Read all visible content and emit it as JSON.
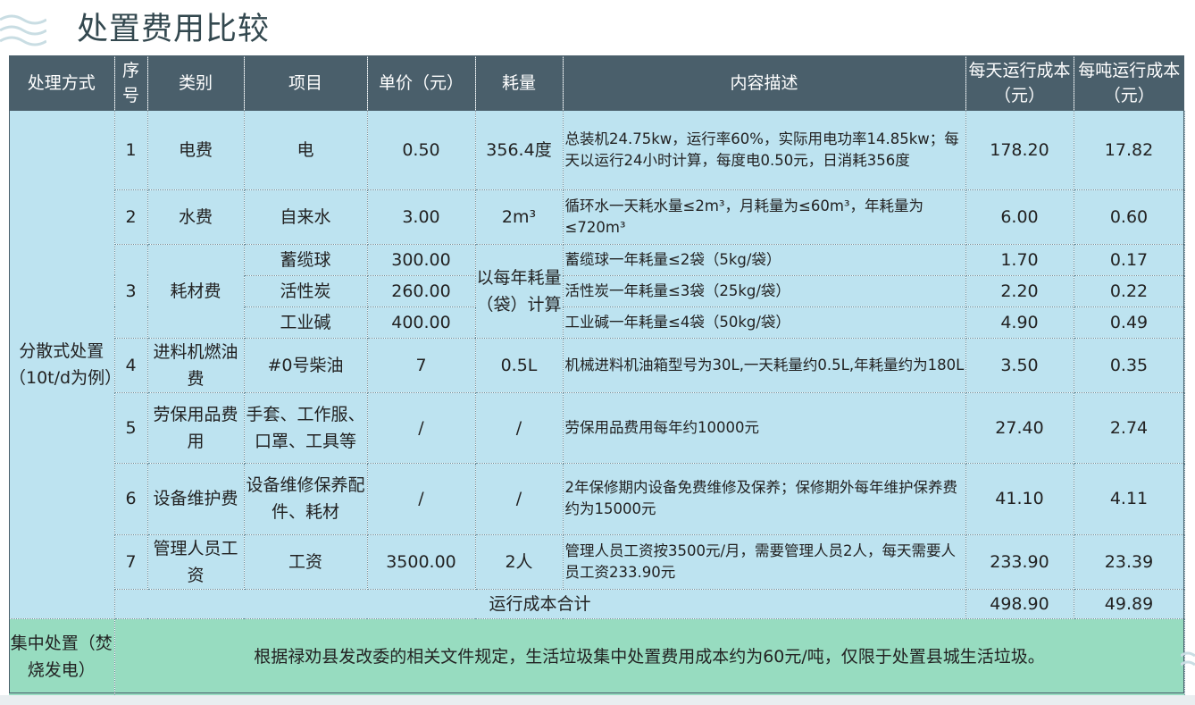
{
  "title": "处置费用比较",
  "colors": {
    "header_bg": "#4a5f6b",
    "row_bg": "#bde3f0",
    "central_bg": "#97dcc0",
    "title_color": "#33484f"
  },
  "table": {
    "headers": [
      "处理方式",
      "序号",
      "类别",
      "项目",
      "单价（元）",
      "耗量",
      "内容描述",
      "每天运行成本（元）",
      "每吨运行成本（元）"
    ],
    "dispersed_method": "分散式处置（10t/d为例）",
    "rows": [
      {
        "no": "1",
        "category": "电费",
        "item": "电",
        "price": "0.50",
        "usage": "356.4度",
        "desc": "总装机24.75kw，运行率60%，实际用电功率14.85kw；每天以运行24小时计算，每度电0.50元，日消耗356度",
        "daily": "178.20",
        "per_ton": "17.82"
      },
      {
        "no": "2",
        "category": "水费",
        "item": "自来水",
        "price": "3.00",
        "usage": "2m³",
        "desc": "循环水一天耗水量≤2m³，月耗量为≤60m³，年耗量为≤720m³",
        "daily": "6.00",
        "per_ton": "0.60"
      },
      {
        "no": "3",
        "category": "耗材费",
        "item": "蓄缆球",
        "price": "300.00",
        "usage": "以每年耗量（袋）计算",
        "desc": "蓄缆球一年耗量≤2袋（5kg/袋）",
        "daily": "1.70",
        "per_ton": "0.17"
      },
      {
        "item": "活性炭",
        "price": "260.00",
        "desc": "活性炭一年耗量≤3袋（25kg/袋）",
        "daily": "2.20",
        "per_ton": "0.22"
      },
      {
        "item": "工业碱",
        "price": "400.00",
        "desc": "工业碱一年耗量≤4袋（50kg/袋）",
        "daily": "4.90",
        "per_ton": "0.49"
      },
      {
        "no": "4",
        "category": "进料机燃油费",
        "item": "#0号柴油",
        "price": "7",
        "usage": "0.5L",
        "desc": "机械进料机油箱型号为30L,一天耗量约0.5L,年耗量约为180L",
        "daily": "3.50",
        "per_ton": "0.35"
      },
      {
        "no": "5",
        "category": "劳保用品费用",
        "item": "手套、工作服、口罩、工具等",
        "price": "/",
        "usage": "/",
        "desc": "劳保用品费用每年约10000元",
        "daily": "27.40",
        "per_ton": "2.74"
      },
      {
        "no": "6",
        "category": "设备维护费",
        "item": "设备维修保养配件、耗材",
        "price": "/",
        "usage": "/",
        "desc": "2年保修期内设备免费维修及保养；保修期外每年维护保养费约为15000元",
        "daily": "41.10",
        "per_ton": "4.11"
      },
      {
        "no": "7",
        "category": "管理人员工资",
        "item": "工资",
        "price": "3500.00",
        "usage": "2人",
        "desc": "管理人员工资按3500元/月，需要管理人员2人，每天需要人员工资233.90元",
        "daily": "233.90",
        "per_ton": "23.39"
      }
    ],
    "total_label": "运行成本合计",
    "total_daily": "498.90",
    "total_per_ton": "49.89",
    "central_method": "集中处置（焚烧发电）",
    "central_note": "根据禄劝县发改委的相关文件规定，生活垃圾集中处置费用成本约为60元/吨，仅限于处置县城生活垃圾。"
  }
}
